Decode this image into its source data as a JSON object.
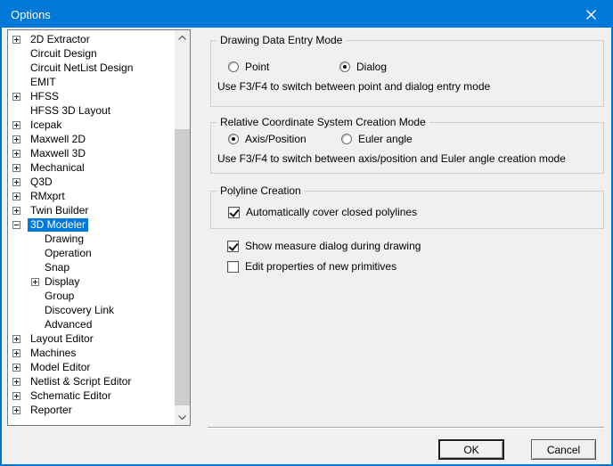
{
  "window": {
    "title": "Options"
  },
  "colors": {
    "accent": "#0078d7",
    "titlebar": "#0078d7",
    "selection": "#0078d7",
    "dialog_bg": "#f0f0f0",
    "tree_bg": "#ffffff",
    "scroll_thumb": "#cdcdcd"
  },
  "icons": {
    "close": "x-cross",
    "scroll_up": "chevron-up",
    "scroll_down": "chevron-down",
    "expand": "plus-box",
    "collapse": "minus-box"
  },
  "tree": {
    "items": [
      {
        "label": "2D Extractor",
        "level": 0,
        "expand": "plus",
        "selected": false
      },
      {
        "label": "Circuit Design",
        "level": 0,
        "expand": null,
        "selected": false
      },
      {
        "label": "Circuit NetList Design",
        "level": 0,
        "expand": null,
        "selected": false
      },
      {
        "label": "EMIT",
        "level": 0,
        "expand": null,
        "selected": false
      },
      {
        "label": "HFSS",
        "level": 0,
        "expand": "plus",
        "selected": false
      },
      {
        "label": "HFSS 3D Layout",
        "level": 0,
        "expand": null,
        "selected": false
      },
      {
        "label": "Icepak",
        "level": 0,
        "expand": "plus",
        "selected": false
      },
      {
        "label": "Maxwell 2D",
        "level": 0,
        "expand": "plus",
        "selected": false
      },
      {
        "label": "Maxwell 3D",
        "level": 0,
        "expand": "plus",
        "selected": false
      },
      {
        "label": "Mechanical",
        "level": 0,
        "expand": "plus",
        "selected": false
      },
      {
        "label": "Q3D",
        "level": 0,
        "expand": "plus",
        "selected": false
      },
      {
        "label": "RMxprt",
        "level": 0,
        "expand": "plus",
        "selected": false
      },
      {
        "label": "Twin Builder",
        "level": 0,
        "expand": "plus",
        "selected": false
      },
      {
        "label": "3D Modeler",
        "level": 0,
        "expand": "minus",
        "selected": true
      },
      {
        "label": "Drawing",
        "level": 1,
        "expand": null,
        "selected": false
      },
      {
        "label": "Operation",
        "level": 1,
        "expand": null,
        "selected": false
      },
      {
        "label": "Snap",
        "level": 1,
        "expand": null,
        "selected": false
      },
      {
        "label": "Display",
        "level": 1,
        "expand": "plus",
        "selected": false
      },
      {
        "label": "Group",
        "level": 1,
        "expand": null,
        "selected": false
      },
      {
        "label": "Discovery Link",
        "level": 1,
        "expand": null,
        "selected": false
      },
      {
        "label": "Advanced",
        "level": 1,
        "expand": null,
        "selected": false
      },
      {
        "label": "Layout Editor",
        "level": 0,
        "expand": "plus",
        "selected": false
      },
      {
        "label": "Machines",
        "level": 0,
        "expand": "plus",
        "selected": false
      },
      {
        "label": "Model Editor",
        "level": 0,
        "expand": "plus",
        "selected": false
      },
      {
        "label": "Netlist & Script Editor",
        "level": 0,
        "expand": "plus",
        "selected": false
      },
      {
        "label": "Schematic Editor",
        "level": 0,
        "expand": "plus",
        "selected": false
      },
      {
        "label": "Reporter",
        "level": 0,
        "expand": "plus",
        "selected": false
      }
    ]
  },
  "panel": {
    "groups": [
      {
        "title": "Drawing Data Entry Mode",
        "radios": [
          {
            "label": "Point",
            "checked": false
          },
          {
            "label": "Dialog",
            "checked": true
          }
        ],
        "hint": "Use F3/F4 to switch between point and dialog entry mode"
      },
      {
        "title": "Relative Coordinate System Creation Mode",
        "radios": [
          {
            "label": "Axis/Position",
            "checked": true
          },
          {
            "label": "Euler angle",
            "checked": false
          }
        ],
        "hint": "Use F3/F4 to switch between axis/position and Euler angle creation mode"
      },
      {
        "title": "Polyline Creation",
        "checkboxes": [
          {
            "label": "Automatically cover closed polylines",
            "checked": true
          }
        ]
      }
    ],
    "checkboxes": [
      {
        "label": "Show measure dialog during drawing",
        "checked": true
      },
      {
        "label": "Edit properties of new primitives",
        "checked": false
      }
    ]
  },
  "buttons": {
    "ok": "OK",
    "cancel": "Cancel"
  }
}
